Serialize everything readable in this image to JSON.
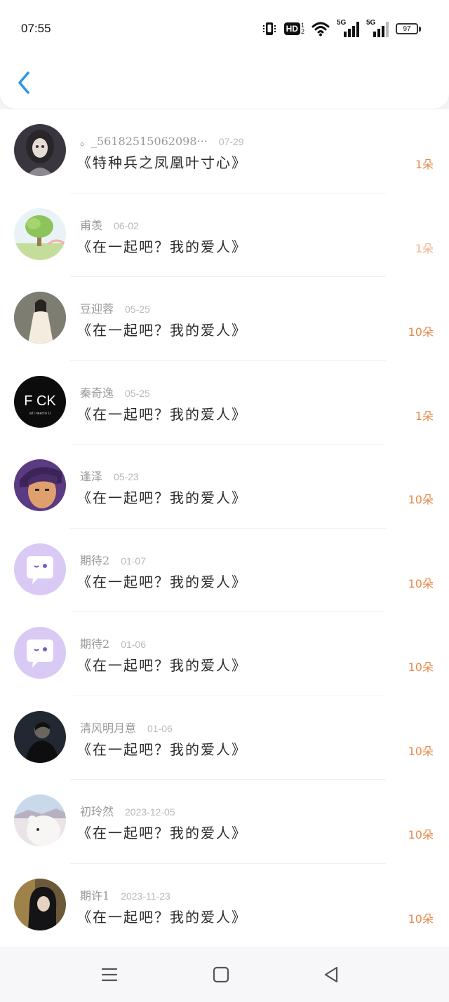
{
  "status": {
    "time": "07:55",
    "hd": "HD",
    "hd_sub": "1\n2",
    "net1": "5G",
    "net2": "5G",
    "battery": "97"
  },
  "header": {
    "back_icon": "chevron-left-icon"
  },
  "colors": {
    "accent": "#e8894a",
    "back": "#2a96e8",
    "name": "#999999",
    "title": "#2b2b2b"
  },
  "items": [
    {
      "name": "。_56182515062098···",
      "date": "07-29",
      "title": "《特种兵之凤凰叶寸心》",
      "count": "1朵",
      "avatar": "girl-doll-avatar"
    },
    {
      "name": "甫羡",
      "date": "06-02",
      "title": "《在一起吧？我的爱人》",
      "count": "1朵",
      "avatar": "tree-avatar"
    },
    {
      "name": "豆迎蓉",
      "date": "05-25",
      "title": "《在一起吧？我的爱人》",
      "count": "10朵",
      "avatar": "girl-dress-avatar"
    },
    {
      "name": "秦奇逸",
      "date": "05-25",
      "title": "《在一起吧？我的爱人》",
      "count": "1朵",
      "avatar": "fck-text-avatar",
      "avatar_text": "F CK",
      "avatar_sub": "all I need is U"
    },
    {
      "name": "逢泽",
      "date": "05-23",
      "title": "《在一起吧？我的爱人》",
      "count": "10朵",
      "avatar": "cartoon-boy-avatar"
    },
    {
      "name": "期待2",
      "date": "01-07",
      "title": "《在一起吧？我的爱人》",
      "count": "10朵",
      "avatar": "chat-bubble-avatar"
    },
    {
      "name": "期待2",
      "date": "01-06",
      "title": "《在一起吧？我的爱人》",
      "count": "10朵",
      "avatar": "chat-bubble-avatar"
    },
    {
      "name": "清风明月意",
      "date": "01-06",
      "title": "《在一起吧？我的爱人》",
      "count": "10朵",
      "avatar": "dark-portrait-avatar"
    },
    {
      "name": "初玲然",
      "date": "2023-12-05",
      "title": "《在一起吧？我的爱人》",
      "count": "10朵",
      "avatar": "bear-avatar"
    },
    {
      "name": "期许1",
      "date": "2023-11-23",
      "title": "《在一起吧？我的爱人》",
      "count": "10朵",
      "avatar": "hooded-girl-avatar"
    }
  ],
  "nav": {
    "menu": "menu-icon",
    "home": "home-square-icon",
    "back": "back-triangle-icon"
  }
}
